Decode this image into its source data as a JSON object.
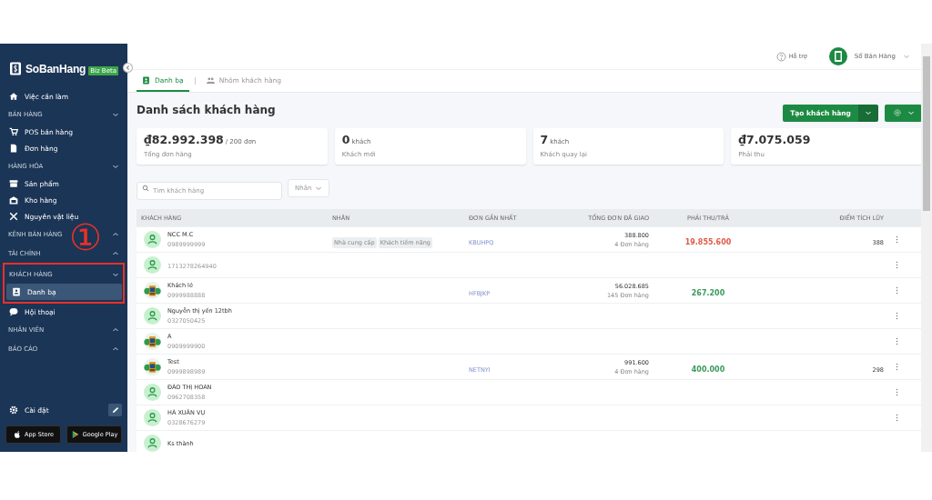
{
  "sidebar": {
    "logo": "SoBanHang",
    "badge": "Biz Beta",
    "items": [
      {
        "kind": "item",
        "label": "Việc cần làm",
        "selected": false
      },
      {
        "kind": "section",
        "label": "BÁN HÀNG",
        "expanded": true,
        "children": [
          {
            "label": "POS bán hàng",
            "selected": false
          },
          {
            "label": "Đơn hàng",
            "selected": false
          }
        ]
      },
      {
        "kind": "section",
        "label": "HÀNG HÓA",
        "expanded": true,
        "children": [
          {
            "label": "Sản phẩm",
            "selected": false
          },
          {
            "label": "Kho hàng",
            "selected": false
          },
          {
            "label": "Nguyên vật liệu",
            "selected": false
          }
        ]
      },
      {
        "kind": "section",
        "label": "KÊNH BÁN HÀNG",
        "expanded": false
      },
      {
        "kind": "section",
        "label": "TÀI CHÍNH",
        "expanded": false
      },
      {
        "kind": "section",
        "label": "KHÁCH HÀNG",
        "expanded": true,
        "highlighted": true,
        "children": [
          {
            "label": "Danh bạ",
            "selected": true
          },
          {
            "label": "Hội thoại",
            "selected": false
          }
        ]
      },
      {
        "kind": "section",
        "label": "NHÂN VIÊN",
        "expanded": false
      },
      {
        "kind": "section",
        "label": "BÁO CÁO",
        "expanded": false
      }
    ],
    "settings": "Cài đặt",
    "stores": [
      "App Store",
      "Google Play"
    ]
  },
  "annotation": "①",
  "header": {
    "help": "Hỗ trợ",
    "account": "Sổ Bán Hàng"
  },
  "tabs": [
    {
      "label": "Danh bạ",
      "selected": true
    },
    {
      "label": "Nhóm khách hàng",
      "selected": false
    }
  ],
  "page_title": "Danh sách khách hàng",
  "create_button": "Tạo khách hàng",
  "stats": [
    {
      "value": "₫82.992.398",
      "unit": "/ 200 đơn",
      "label": "Tổng đơn hàng"
    },
    {
      "value": "0",
      "unit": "khách",
      "label": "Khách mới"
    },
    {
      "value": "7",
      "unit": "khách",
      "label": "Khách quay lại"
    },
    {
      "value": "₫7.075.059",
      "label": "Phải thu"
    }
  ],
  "search": {
    "placeholder": "Tìm khách hàng"
  },
  "label_filter": "Nhãn",
  "table": {
    "columns": [
      "KHÁCH HÀNG",
      "NHÃN",
      "ĐƠN GẦN NHẤT",
      "TỔNG ĐƠN ĐÃ GIAO",
      "PHẢI THU/TRẢ",
      "ĐIỂM TÍCH LŨY"
    ],
    "rows": [
      {
        "kind": "person",
        "name": "NCC M.C",
        "phone": "0989999999",
        "tags": [
          "Nhà cung cấp",
          "Khách tiềm năng"
        ],
        "last_order": "KBUHPQ",
        "total": "388.800",
        "orders": "4 Đơn hàng",
        "balance": "19.855.600",
        "color": "#e05a47",
        "points": "388"
      },
      {
        "kind": "person",
        "phone": "1713278264940"
      },
      {
        "kind": "picture",
        "name": "Khách lẻ",
        "phone": "0999988888",
        "last_order": "HFBJKP",
        "total": "56.028.685",
        "orders": "145 Đơn hàng",
        "balance": "267.200",
        "color": "#3a9a5b"
      },
      {
        "kind": "person",
        "name": "Nguyễn thị yến 12tbh",
        "phone": "0327050425"
      },
      {
        "kind": "picture",
        "name": "A",
        "phone": "0909999900"
      },
      {
        "kind": "picture",
        "name": "Test",
        "phone": "0999898989",
        "last_order": "NETNYI",
        "total": "991.600",
        "orders": "4 Đơn hàng",
        "balance": "400.000",
        "color": "#3a9a5b",
        "points": "298"
      },
      {
        "kind": "person",
        "name": "ĐÀO THỊ HOAN",
        "phone": "0962708358"
      },
      {
        "kind": "person",
        "name": "HÀ XUÂN VỤ",
        "phone": "0328676279"
      },
      {
        "kind": "person",
        "name": "Ks thành"
      }
    ]
  }
}
